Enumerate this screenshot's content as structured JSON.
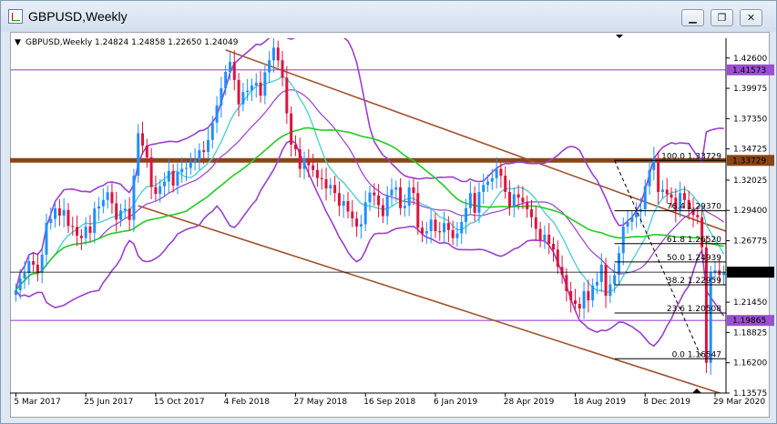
{
  "window": {
    "title": "GBPUSD,Weekly"
  },
  "controls": {
    "minimize": "▁",
    "maximize": "❐",
    "close": "✕"
  },
  "chart_data": {
    "type": "candlestick",
    "symbol_header": "GBPUSD,Weekly",
    "ohlc_header": "1.24824 1.24858 1.22650 1.24049",
    "last_price": 1.24049,
    "ylim": [
      1.13575,
      1.44
    ],
    "y_ticks": [
      1.426,
      1.39975,
      1.3735,
      1.34725,
      1.32025,
      1.294,
      1.26775,
      1.24049,
      1.2145,
      1.18825,
      1.162,
      1.13575
    ],
    "x_ticks": [
      "5 Mar 2017",
      "25 Jun 2017",
      "15 Oct 2017",
      "4 Feb 2018",
      "27 May 2018",
      "16 Sep 2018",
      "6 Jan 2019",
      "28 Apr 2019",
      "18 Aug 2019",
      "8 Dec 2019",
      "29 Mar 2020"
    ],
    "x_tick_weeks": [
      0,
      16,
      32,
      48,
      64,
      80,
      96,
      112,
      128,
      144,
      160
    ],
    "horizontal_levels": [
      {
        "value": 1.41573,
        "color": "#9b4fd1"
      },
      {
        "value": 1.33729,
        "color": "#8b4513"
      },
      {
        "value": 1.19865,
        "color": "#9b4fd1"
      }
    ],
    "fibonacci": [
      {
        "label": "100.0 1.33729",
        "value": 1.33729
      },
      {
        "label": "76.4 1.29370",
        "value": 1.2937
      },
      {
        "label": "61.8 1.26520",
        "value": 1.2652
      },
      {
        "label": "50.0 1.24939",
        "value": 1.24939
      },
      {
        "label": "38.2 1.22959",
        "value": 1.22959
      },
      {
        "label": "23.6 1.20508",
        "value": 1.20508
      },
      {
        "label": "0.0 1.16547",
        "value": 1.16547
      }
    ],
    "channel_lines": [
      {
        "from": [
          0.0,
          1.431
        ],
        "to": [
          11.55,
          1.292
        ]
      },
      {
        "from": [
          0.0,
          1.297
        ],
        "to": [
          11.55,
          1.161
        ]
      }
    ],
    "closes": [
      1.2248,
      1.235,
      1.2398,
      1.25,
      1.247,
      1.24,
      1.2556,
      1.2832,
      1.2866,
      1.2958,
      1.2895,
      1.2944,
      1.2805,
      1.2797,
      1.272,
      1.27,
      1.28,
      1.2745,
      1.2956,
      1.2975,
      1.303,
      1.3097,
      1.3001,
      1.286,
      1.2939,
      1.2954,
      1.2857,
      1.324,
      1.3608,
      1.3501,
      1.34,
      1.3142,
      1.3083,
      1.3149,
      1.319,
      1.3282,
      1.3155,
      1.327,
      1.33,
      1.3308,
      1.3361,
      1.3379,
      1.3461,
      1.3446,
      1.355,
      1.37,
      1.385,
      1.3998,
      1.414,
      1.4226,
      1.407,
      1.3859,
      1.3965,
      1.3978,
      1.4022,
      1.4047,
      1.3934,
      1.4136,
      1.424,
      1.435,
      1.424,
      1.409,
      1.378,
      1.351,
      1.347,
      1.33,
      1.339,
      1.333,
      1.329,
      1.322,
      1.321,
      1.313,
      1.316,
      1.309,
      1.298,
      1.302,
      1.293,
      1.287,
      1.28,
      1.282,
      1.301,
      1.3095,
      1.307,
      1.2985,
      1.289,
      1.307,
      1.312,
      1.314,
      1.296,
      1.298,
      1.314,
      1.309,
      1.279,
      1.274,
      1.276,
      1.286,
      1.276,
      1.275,
      1.283,
      1.277,
      1.27,
      1.274,
      1.284,
      1.296,
      1.309,
      1.292,
      1.31,
      1.316,
      1.319,
      1.322,
      1.33,
      1.324,
      1.31,
      1.297,
      1.308,
      1.305,
      1.301,
      1.295,
      1.288,
      1.278,
      1.268,
      1.273,
      1.265,
      1.26,
      1.245,
      1.238,
      1.224,
      1.216,
      1.213,
      1.209,
      1.224,
      1.216,
      1.229,
      1.232,
      1.247,
      1.22,
      1.23,
      1.238,
      1.257,
      1.28,
      1.284,
      1.288,
      1.293,
      1.295,
      1.315,
      1.329,
      1.339,
      1.31,
      1.312,
      1.308,
      1.305,
      1.294,
      1.309,
      1.303,
      1.295,
      1.29,
      1.288,
      1.262,
      1.162,
      1.24,
      1.242,
      1.238,
      1.2405
    ]
  }
}
